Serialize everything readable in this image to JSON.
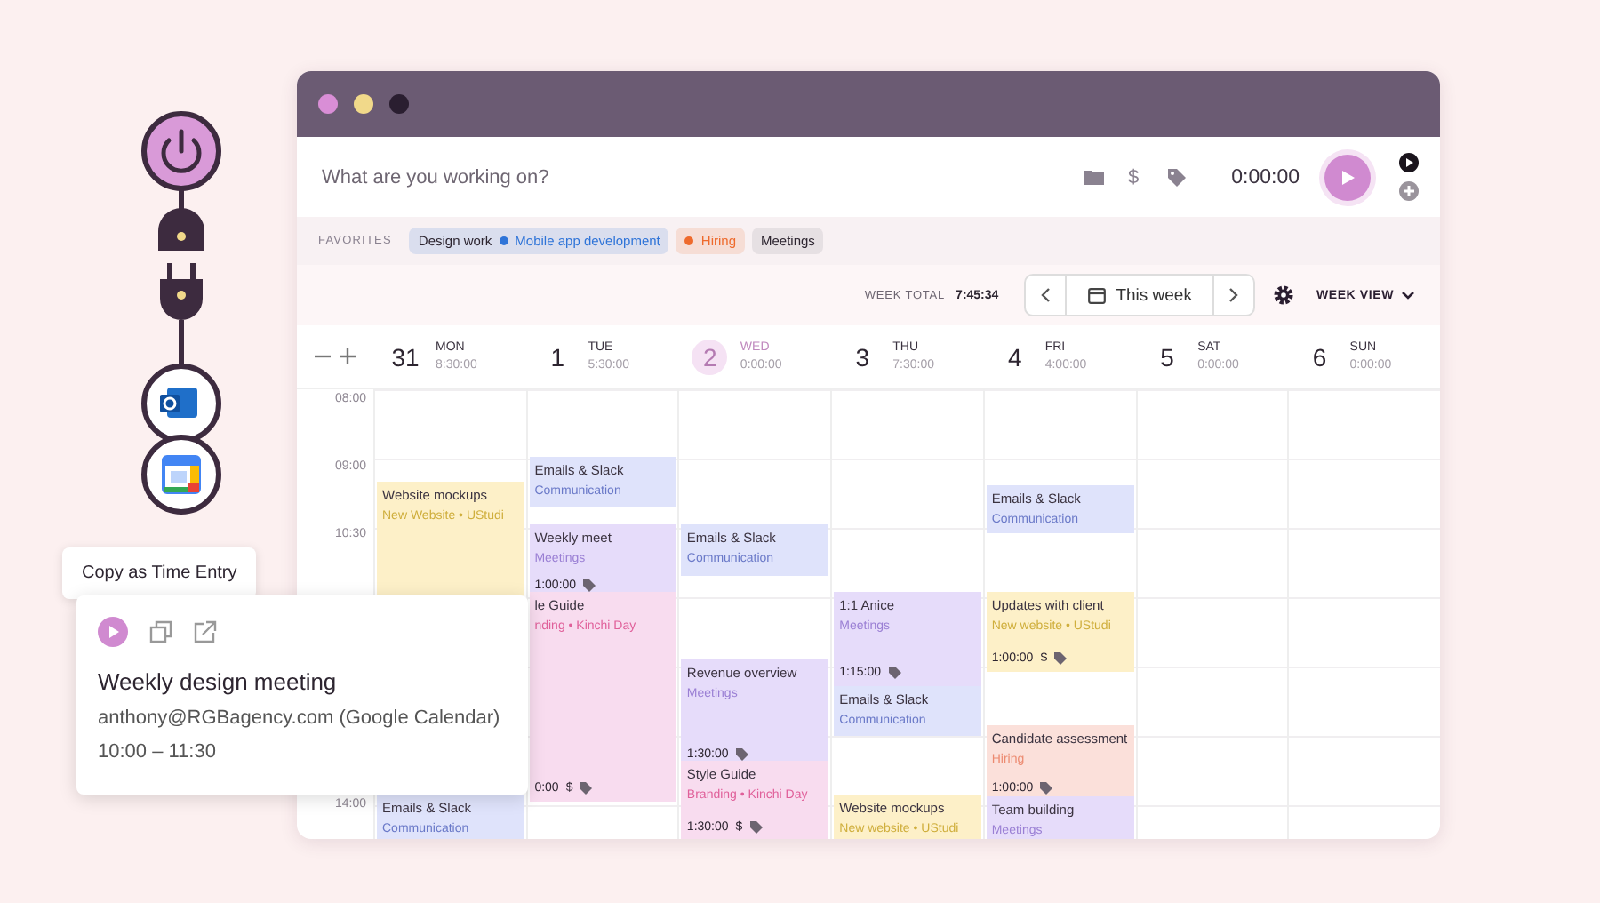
{
  "timer": {
    "placeholder": "What are you working on?",
    "billable_mark": "$",
    "time": "0:00:00"
  },
  "favorites": {
    "label": "FAVORITES",
    "items": [
      {
        "task": "Design work",
        "project": "Mobile app development",
        "color": "#2f74d8"
      },
      {
        "project": "Hiring",
        "color": "#ee6a2c"
      },
      {
        "task": "Meetings"
      }
    ]
  },
  "toolbar": {
    "total_label": "WEEK TOTAL",
    "total": "7:45:34",
    "range": "This week",
    "view": "WEEK VIEW"
  },
  "time_labels": [
    "08:00",
    "09:00",
    "10:30",
    "14:00"
  ],
  "days": [
    {
      "date": "31",
      "name": "MON",
      "total": "8:30:00",
      "selected": false,
      "events": [
        {
          "kind": "project",
          "title": "Website mockups",
          "project": "New Website • UStudi"
        },
        {
          "kind": "communication",
          "title": "Emails & Slack",
          "project": "Communication"
        }
      ]
    },
    {
      "date": "1",
      "name": "TUE",
      "total": "5:30:00",
      "selected": false,
      "events": [
        {
          "kind": "communication",
          "title": "Emails & Slack",
          "project": "Communication"
        },
        {
          "kind": "meeting",
          "title": "Weekly meet",
          "project": "Meetings",
          "duration": "1:00:00",
          "tagged": true
        },
        {
          "kind": "branding",
          "title": "le Guide",
          "project": "nding • Kinchi Day",
          "duration": "0:00",
          "billable": "$",
          "tagged": true
        }
      ]
    },
    {
      "date": "2",
      "name": "WED",
      "total": "0:00:00",
      "selected": true,
      "events": [
        {
          "kind": "communication",
          "title": "Emails & Slack",
          "project": "Communication"
        },
        {
          "kind": "meeting",
          "title": "Revenue overview",
          "project": "Meetings",
          "duration": "1:30:00",
          "tagged": true
        },
        {
          "kind": "branding",
          "title": "Style Guide",
          "project": "Branding • Kinchi Day",
          "duration": "1:30:00",
          "billable": "$",
          "tagged": true
        }
      ]
    },
    {
      "date": "3",
      "name": "THU",
      "total": "7:30:00",
      "selected": false,
      "events": [
        {
          "kind": "meeting",
          "title": "1:1 Anice",
          "project": "Meetings",
          "duration": "1:15:00",
          "tagged": true
        },
        {
          "kind": "communication",
          "title": "Emails & Slack",
          "project": "Communication"
        },
        {
          "kind": "project",
          "title": "Website mockups",
          "project": "New website • UStudi"
        }
      ]
    },
    {
      "date": "4",
      "name": "FRI",
      "total": "4:00:00",
      "selected": false,
      "events": [
        {
          "kind": "communication",
          "title": "Emails & Slack",
          "project": "Communication"
        },
        {
          "kind": "project",
          "title": "Updates with client",
          "project": "New website • UStudi",
          "duration": "1:00:00",
          "billable": "$",
          "tagged": true
        },
        {
          "kind": "hiring",
          "title": "Candidate assessment",
          "project": "Hiring",
          "duration": "1:00:00",
          "tagged": true
        },
        {
          "kind": "meeting",
          "title": "Team building",
          "project": "Meetings"
        }
      ]
    },
    {
      "date": "5",
      "name": "SAT",
      "total": "0:00:00",
      "selected": false
    },
    {
      "date": "6",
      "name": "SUN",
      "total": "0:00:00",
      "selected": false
    }
  ],
  "tooltip": "Copy as Time Entry",
  "popup": {
    "title": "Weekly design meeting",
    "source": "anthony@RGBagency.com (Google Calendar)",
    "time": "10:00 – 11:30"
  }
}
